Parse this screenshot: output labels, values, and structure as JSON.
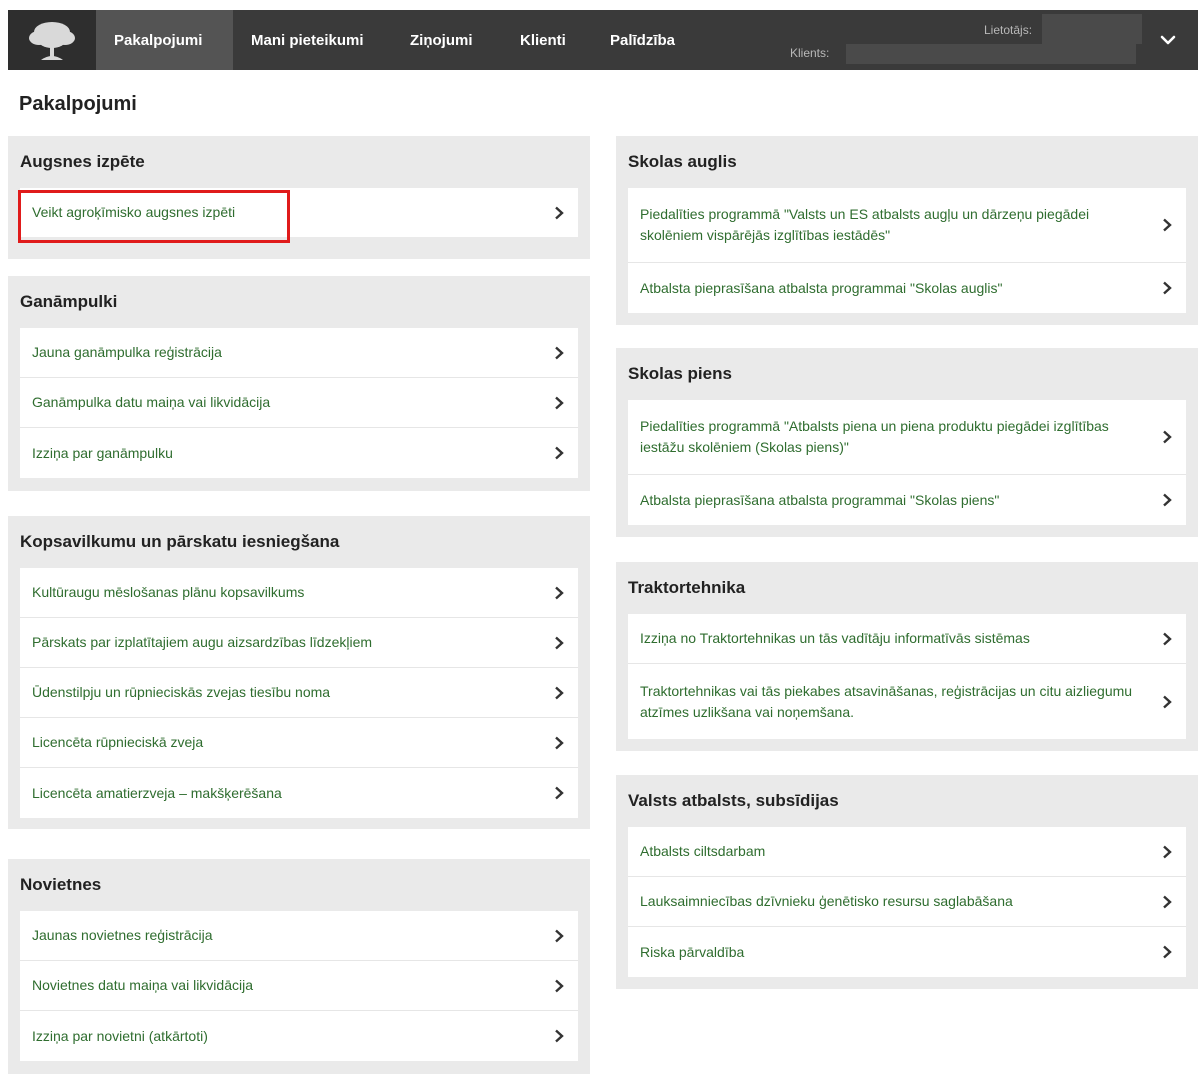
{
  "nav": {
    "items": [
      "Pakalpojumi",
      "Mani pieteikumi",
      "Ziņojumi",
      "Klienti",
      "Palīdzība"
    ],
    "user_label": "Lietotājs:",
    "client_label": "Klients:"
  },
  "page": {
    "title": "Pakalpojumi"
  },
  "left_panels": [
    {
      "title": "Augsnes izpēte",
      "items": [
        "Veikt agroķīmisko augsnes izpēti"
      ]
    },
    {
      "title": "Ganāmpulki",
      "items": [
        "Jauna ganāmpulka reģistrācija",
        "Ganāmpulka datu maiņa vai likvidācija",
        "Izziņa par ganāmpulku"
      ]
    },
    {
      "title": "Kopsavilkumu un pārskatu iesniegšana",
      "items": [
        "Kultūraugu mēslošanas plānu kopsavilkums",
        "Pārskats par izplatītajiem augu aizsardzības līdzekļiem",
        "Ūdenstilpju un rūpnieciskās zvejas tiesību noma",
        "Licencēta rūpnieciskā zveja",
        "Licencēta amatierzveja – makšķerēšana"
      ]
    },
    {
      "title": "Novietnes",
      "items": [
        "Jaunas novietnes reģistrācija",
        "Novietnes datu maiņa vai likvidācija",
        "Izziņa par novietni (atkārtoti)"
      ]
    }
  ],
  "right_panels": [
    {
      "title": "Skolas auglis",
      "items": [
        "Piedalīties programmā \"Valsts un ES atbalsts augļu un dārzeņu piegādei skolēniem vispārējās izglītības iestādēs\"",
        "Atbalsta pieprasīšana atbalsta programmai \"Skolas auglis\""
      ]
    },
    {
      "title": "Skolas piens",
      "items": [
        "Piedalīties programmā \"Atbalsts piena un piena produktu piegādei izglītības iestāžu skolēniem (Skolas piens)\"",
        "Atbalsta pieprasīšana atbalsta programmai \"Skolas piens\""
      ]
    },
    {
      "title": "Traktortehnika",
      "items": [
        "Izziņa no Traktortehnikas un tās vadītāju informatīvās sistēmas",
        "Traktortehnikas vai tās piekabes atsavināšanas, reģistrācijas un citu aizliegumu atzīmes uzlikšana vai noņemšana."
      ]
    },
    {
      "title": "Valsts atbalsts, subsīdijas",
      "items": [
        "Atbalsts ciltsdarbam",
        "Lauksaimniecības dzīvnieku ģenētisko resursu saglabāšana",
        "Riska pārvaldība"
      ]
    }
  ],
  "colors": {
    "topbar": "#3a3a3a",
    "nav_active": "#545454",
    "panel_bg": "#eaeaea",
    "link_text": "#2f6d2f",
    "highlight": "#e01b1b"
  }
}
